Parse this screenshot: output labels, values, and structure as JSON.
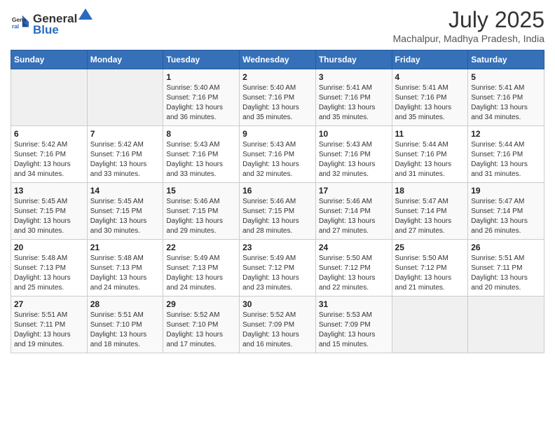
{
  "header": {
    "logo_general": "General",
    "logo_blue": "Blue",
    "month_year": "July 2025",
    "location": "Machalpur, Madhya Pradesh, India"
  },
  "weekdays": [
    "Sunday",
    "Monday",
    "Tuesday",
    "Wednesday",
    "Thursday",
    "Friday",
    "Saturday"
  ],
  "weeks": [
    [
      {
        "day": "",
        "empty": true
      },
      {
        "day": "",
        "empty": true
      },
      {
        "day": "1",
        "sunrise": "Sunrise: 5:40 AM",
        "sunset": "Sunset: 7:16 PM",
        "daylight": "Daylight: 13 hours and 36 minutes."
      },
      {
        "day": "2",
        "sunrise": "Sunrise: 5:40 AM",
        "sunset": "Sunset: 7:16 PM",
        "daylight": "Daylight: 13 hours and 35 minutes."
      },
      {
        "day": "3",
        "sunrise": "Sunrise: 5:41 AM",
        "sunset": "Sunset: 7:16 PM",
        "daylight": "Daylight: 13 hours and 35 minutes."
      },
      {
        "day": "4",
        "sunrise": "Sunrise: 5:41 AM",
        "sunset": "Sunset: 7:16 PM",
        "daylight": "Daylight: 13 hours and 35 minutes."
      },
      {
        "day": "5",
        "sunrise": "Sunrise: 5:41 AM",
        "sunset": "Sunset: 7:16 PM",
        "daylight": "Daylight: 13 hours and 34 minutes."
      }
    ],
    [
      {
        "day": "6",
        "sunrise": "Sunrise: 5:42 AM",
        "sunset": "Sunset: 7:16 PM",
        "daylight": "Daylight: 13 hours and 34 minutes."
      },
      {
        "day": "7",
        "sunrise": "Sunrise: 5:42 AM",
        "sunset": "Sunset: 7:16 PM",
        "daylight": "Daylight: 13 hours and 33 minutes."
      },
      {
        "day": "8",
        "sunrise": "Sunrise: 5:43 AM",
        "sunset": "Sunset: 7:16 PM",
        "daylight": "Daylight: 13 hours and 33 minutes."
      },
      {
        "day": "9",
        "sunrise": "Sunrise: 5:43 AM",
        "sunset": "Sunset: 7:16 PM",
        "daylight": "Daylight: 13 hours and 32 minutes."
      },
      {
        "day": "10",
        "sunrise": "Sunrise: 5:43 AM",
        "sunset": "Sunset: 7:16 PM",
        "daylight": "Daylight: 13 hours and 32 minutes."
      },
      {
        "day": "11",
        "sunrise": "Sunrise: 5:44 AM",
        "sunset": "Sunset: 7:16 PM",
        "daylight": "Daylight: 13 hours and 31 minutes."
      },
      {
        "day": "12",
        "sunrise": "Sunrise: 5:44 AM",
        "sunset": "Sunset: 7:16 PM",
        "daylight": "Daylight: 13 hours and 31 minutes."
      }
    ],
    [
      {
        "day": "13",
        "sunrise": "Sunrise: 5:45 AM",
        "sunset": "Sunset: 7:15 PM",
        "daylight": "Daylight: 13 hours and 30 minutes."
      },
      {
        "day": "14",
        "sunrise": "Sunrise: 5:45 AM",
        "sunset": "Sunset: 7:15 PM",
        "daylight": "Daylight: 13 hours and 30 minutes."
      },
      {
        "day": "15",
        "sunrise": "Sunrise: 5:46 AM",
        "sunset": "Sunset: 7:15 PM",
        "daylight": "Daylight: 13 hours and 29 minutes."
      },
      {
        "day": "16",
        "sunrise": "Sunrise: 5:46 AM",
        "sunset": "Sunset: 7:15 PM",
        "daylight": "Daylight: 13 hours and 28 minutes."
      },
      {
        "day": "17",
        "sunrise": "Sunrise: 5:46 AM",
        "sunset": "Sunset: 7:14 PM",
        "daylight": "Daylight: 13 hours and 27 minutes."
      },
      {
        "day": "18",
        "sunrise": "Sunrise: 5:47 AM",
        "sunset": "Sunset: 7:14 PM",
        "daylight": "Daylight: 13 hours and 27 minutes."
      },
      {
        "day": "19",
        "sunrise": "Sunrise: 5:47 AM",
        "sunset": "Sunset: 7:14 PM",
        "daylight": "Daylight: 13 hours and 26 minutes."
      }
    ],
    [
      {
        "day": "20",
        "sunrise": "Sunrise: 5:48 AM",
        "sunset": "Sunset: 7:13 PM",
        "daylight": "Daylight: 13 hours and 25 minutes."
      },
      {
        "day": "21",
        "sunrise": "Sunrise: 5:48 AM",
        "sunset": "Sunset: 7:13 PM",
        "daylight": "Daylight: 13 hours and 24 minutes."
      },
      {
        "day": "22",
        "sunrise": "Sunrise: 5:49 AM",
        "sunset": "Sunset: 7:13 PM",
        "daylight": "Daylight: 13 hours and 24 minutes."
      },
      {
        "day": "23",
        "sunrise": "Sunrise: 5:49 AM",
        "sunset": "Sunset: 7:12 PM",
        "daylight": "Daylight: 13 hours and 23 minutes."
      },
      {
        "day": "24",
        "sunrise": "Sunrise: 5:50 AM",
        "sunset": "Sunset: 7:12 PM",
        "daylight": "Daylight: 13 hours and 22 minutes."
      },
      {
        "day": "25",
        "sunrise": "Sunrise: 5:50 AM",
        "sunset": "Sunset: 7:12 PM",
        "daylight": "Daylight: 13 hours and 21 minutes."
      },
      {
        "day": "26",
        "sunrise": "Sunrise: 5:51 AM",
        "sunset": "Sunset: 7:11 PM",
        "daylight": "Daylight: 13 hours and 20 minutes."
      }
    ],
    [
      {
        "day": "27",
        "sunrise": "Sunrise: 5:51 AM",
        "sunset": "Sunset: 7:11 PM",
        "daylight": "Daylight: 13 hours and 19 minutes."
      },
      {
        "day": "28",
        "sunrise": "Sunrise: 5:51 AM",
        "sunset": "Sunset: 7:10 PM",
        "daylight": "Daylight: 13 hours and 18 minutes."
      },
      {
        "day": "29",
        "sunrise": "Sunrise: 5:52 AM",
        "sunset": "Sunset: 7:10 PM",
        "daylight": "Daylight: 13 hours and 17 minutes."
      },
      {
        "day": "30",
        "sunrise": "Sunrise: 5:52 AM",
        "sunset": "Sunset: 7:09 PM",
        "daylight": "Daylight: 13 hours and 16 minutes."
      },
      {
        "day": "31",
        "sunrise": "Sunrise: 5:53 AM",
        "sunset": "Sunset: 7:09 PM",
        "daylight": "Daylight: 13 hours and 15 minutes."
      },
      {
        "day": "",
        "empty": true
      },
      {
        "day": "",
        "empty": true
      }
    ]
  ]
}
